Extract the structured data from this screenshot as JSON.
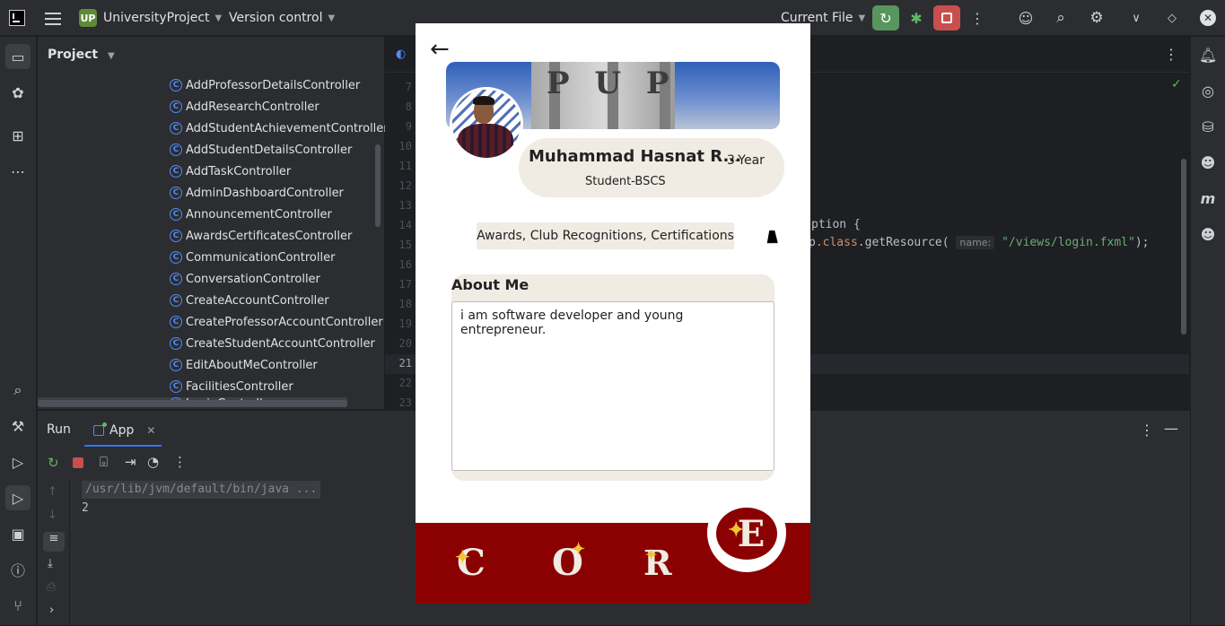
{
  "titlebar": {
    "project_badge": "UP",
    "project_name": "UniversityProject",
    "version_control": "Version control",
    "run_config": "Current File"
  },
  "project_panel": {
    "title": "Project",
    "items": [
      "AddProfessorDetailsController",
      "AddResearchController",
      "AddStudentAchievementController",
      "AddStudentDetailsController",
      "AddTaskController",
      "AdminDashboardController",
      "AnnouncementController",
      "AwardsCertificatesController",
      "CommunicationController",
      "ConversationController",
      "CreateAccountController",
      "CreateProfessorAccountController",
      "CreateStudentAccountController",
      "EditAboutMeController",
      "FacilitiesController",
      "LoginController"
    ],
    "class_icon_letter": "C"
  },
  "editor": {
    "line_numbers": [
      "7",
      "8",
      "9",
      "10",
      "11",
      "12",
      "13",
      "14",
      "15",
      "16",
      "17",
      "18",
      "19",
      "20",
      "21",
      "22",
      "23"
    ],
    "code_line14": "ption {",
    "code_line15_a": "p",
    "code_line15_class": ".class",
    "code_line15_b": ".getResource(",
    "code_line15_hint": "name:",
    "code_line15_str": "\"/views/login.fxml\"",
    "code_line15_end": ");"
  },
  "run_panel": {
    "tab_run": "Run",
    "tab_app": "App",
    "console_line1": "/usr/lib/jvm/default/bin/java ...",
    "console_line2": "2"
  },
  "app": {
    "back_arrow": "←",
    "banner_text": "P U P",
    "name": "Muhammad Hasnat R...",
    "year": "3-Year",
    "program": "Student-BSCS",
    "awards_button": "Awards, Club Recognitions, Certifications",
    "about_title": "About Me",
    "about_text": "i am software developer and young entrepreneur.",
    "nav": {
      "letter_c": "C",
      "letter_o": "O",
      "letter_r": "R",
      "letter_e": "E"
    },
    "colors": {
      "maroon": "#8b0000",
      "cream": "#f0ebe3"
    }
  }
}
